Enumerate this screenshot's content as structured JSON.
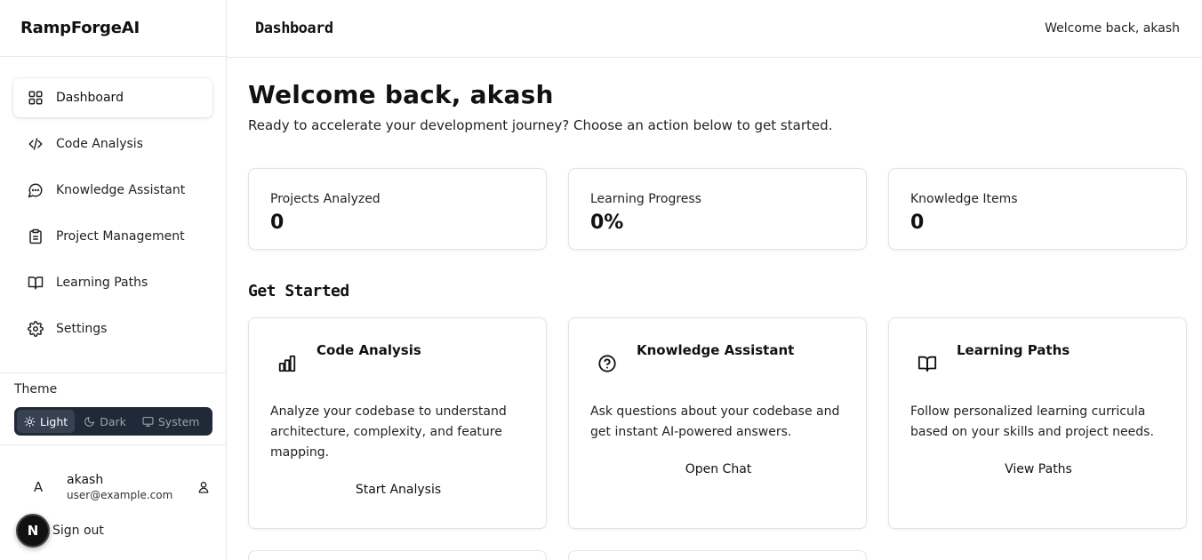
{
  "app": {
    "brand": "RampForgeAI"
  },
  "sidebar": {
    "items": [
      {
        "label": "Dashboard",
        "icon": "grid-icon",
        "active": true
      },
      {
        "label": "Code Analysis",
        "icon": "code-icon"
      },
      {
        "label": "Knowledge Assistant",
        "icon": "chat-bubble-icon"
      },
      {
        "label": "Project Management",
        "icon": "clipboard-icon"
      },
      {
        "label": "Learning Paths",
        "icon": "book-open-icon"
      },
      {
        "label": "Settings",
        "icon": "gear-icon"
      }
    ]
  },
  "theme": {
    "label": "Theme",
    "options": [
      {
        "label": "Light",
        "icon": "sun-icon",
        "active": true
      },
      {
        "label": "Dark",
        "icon": "moon-icon"
      },
      {
        "label": "System",
        "icon": "monitor-icon"
      }
    ]
  },
  "user": {
    "initial": "A",
    "name": "akash",
    "email": "user@example.com",
    "signout_label": "Sign out",
    "badge": "N"
  },
  "header": {
    "title": "Dashboard",
    "welcome": "Welcome back, akash"
  },
  "main": {
    "title": "Welcome back, akash",
    "subtitle": "Ready to accelerate your development journey? Choose an action below to get started.",
    "stats": [
      {
        "label": "Projects Analyzed",
        "value": "0"
      },
      {
        "label": "Learning Progress",
        "value": "0%"
      },
      {
        "label": "Knowledge Items",
        "value": "0"
      }
    ],
    "section_title": "Get Started",
    "actions": [
      {
        "title": "Code Analysis",
        "icon": "bar-chart-icon",
        "description": "Analyze your codebase to understand architecture, complexity, and feature mapping.",
        "button": "Start Analysis"
      },
      {
        "title": "Knowledge Assistant",
        "icon": "help-circle-icon",
        "description": "Ask questions about your codebase and get instant AI-powered answers.",
        "button": "Open Chat"
      },
      {
        "title": "Learning Paths",
        "icon": "book-open-icon",
        "description": "Follow personalized learning curricula based on your skills and project needs.",
        "button": "View Paths"
      }
    ]
  }
}
